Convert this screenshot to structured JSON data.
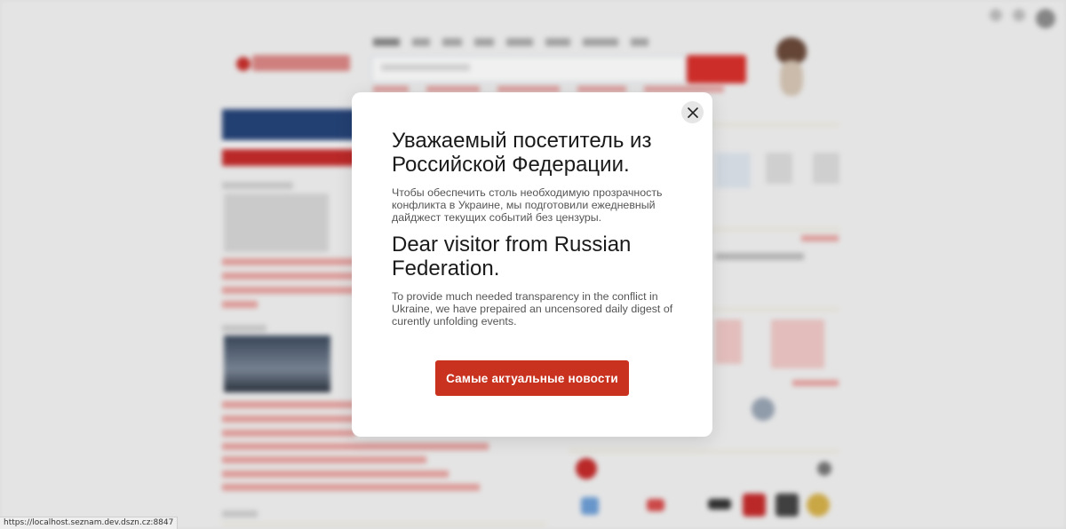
{
  "modal": {
    "heading_ru": "Уважаемый посетитель из Российской Федерации.",
    "text_ru": "Чтобы обеспечить столь необходимую прозрачность конфликта в Украине, мы подготовили ежедневный дайджест текущих событий без цензуры.",
    "heading_en": "Dear visitor from Russian Federation.",
    "text_en": "To provide much needed transparency in the conflict in Ukraine, we have prepaired an uncensored daily digest of curently unfolding events.",
    "cta_label": "Самые актуальные новости",
    "close_icon": "close-icon"
  },
  "status_bar": {
    "url": "https://localhost.seznam.dev.dszn.cz:8847"
  },
  "colors": {
    "cta": "#c8321f",
    "accent_red": "#d9302b",
    "close_bg": "#e6e6e6"
  }
}
